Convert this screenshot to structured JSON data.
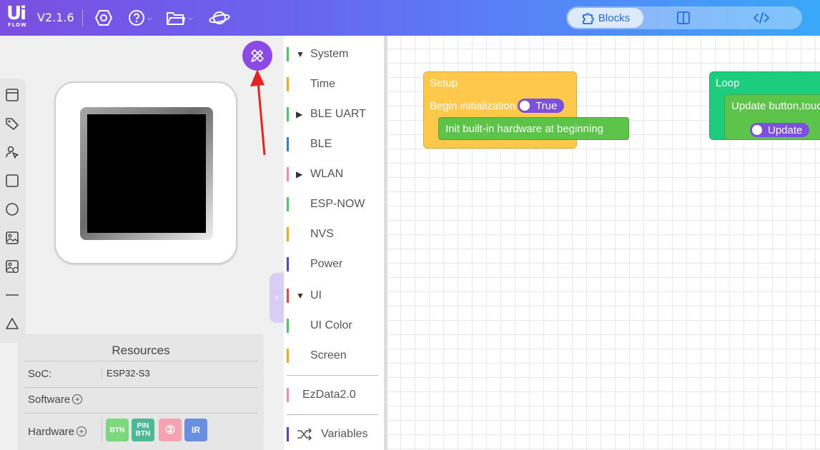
{
  "app": {
    "logo_main": "Ui",
    "logo_sub": "FLOW",
    "version": "V2.1.6"
  },
  "toolbar": {
    "icons": [
      "settings-hex-icon",
      "help-icon",
      "folder-icon",
      "planet-icon"
    ]
  },
  "views": {
    "blocks_label": "Blocks",
    "active": "Blocks"
  },
  "resources": {
    "title": "Resources",
    "soc_label": "SoC:",
    "soc_value": "ESP32-S3",
    "software_label": "Software",
    "hardware_label": "Hardware",
    "hardware_badges": [
      {
        "label": "BTN",
        "color": "#7dd87d"
      },
      {
        "label": "PIN BTN",
        "color": "#4cb894"
      },
      {
        "label": "②",
        "color": "#f5a3b0"
      },
      {
        "label": "IR",
        "color": "#6a8ee0"
      }
    ]
  },
  "categories": [
    {
      "label": "System",
      "color": "#4cc46a",
      "arrow": "down"
    },
    {
      "label": "Time",
      "color": "#f5a623",
      "arrow": ""
    },
    {
      "label": "BLE UART",
      "color": "#4cc46a",
      "arrow": "right"
    },
    {
      "label": "BLE",
      "color": "#2f7fe0",
      "arrow": ""
    },
    {
      "label": "WLAN",
      "color": "#f28ca0",
      "arrow": "right"
    },
    {
      "label": "ESP-NOW",
      "color": "#4cc46a",
      "arrow": ""
    },
    {
      "label": "NVS",
      "color": "#f5a623",
      "arrow": ""
    },
    {
      "label": "Power",
      "color": "#5b3fd0",
      "arrow": ""
    },
    {
      "label": "UI",
      "color": "#e04848",
      "arrow": "down"
    },
    {
      "label": "UI Color",
      "color": "#4cc46a",
      "arrow": ""
    },
    {
      "label": "Screen",
      "color": "#f5a623",
      "arrow": ""
    },
    {
      "label": "EzData2.0",
      "color": "#f28ca0",
      "arrow": ""
    },
    {
      "label": "Variables",
      "color": "#5b3fd0",
      "arrow": ""
    }
  ],
  "blocks": {
    "setup": {
      "title": "Setup",
      "begin_label": "Begin initialization",
      "toggle_label": "True",
      "init_label": "Init built-in hardware at beginning",
      "color": "#fec84a"
    },
    "loop": {
      "title": "Loop",
      "update_label": "Update button,touch",
      "toggle_label": "Update",
      "color": "#1ccd7e"
    }
  }
}
